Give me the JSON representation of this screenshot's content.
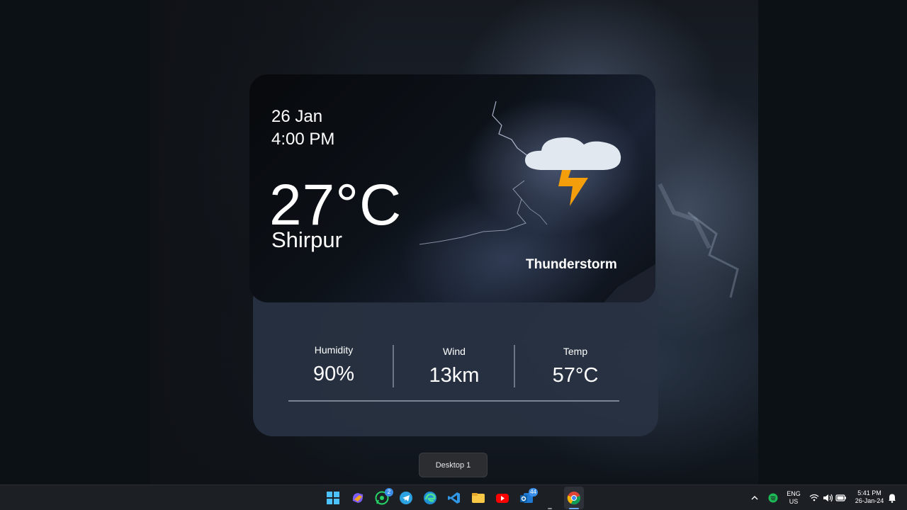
{
  "weather": {
    "date": "26 Jan",
    "time": "4:00 PM",
    "temperature": "27°C",
    "city": "Shirpur",
    "condition": "Thunderstorm",
    "icon": "thunderstorm-icon"
  },
  "stats": [
    {
      "label": "Humidity",
      "value": "90%"
    },
    {
      "label": "Wind",
      "value": "13km"
    },
    {
      "label": "Temp",
      "value": "57°C"
    }
  ],
  "desktop_tooltip": "Desktop 1",
  "taskbar": {
    "apps": [
      {
        "name": "start-icon"
      },
      {
        "name": "copilot-icon"
      },
      {
        "name": "whatsapp-icon",
        "badge": "2"
      },
      {
        "name": "telegram-icon"
      },
      {
        "name": "edge-icon"
      },
      {
        "name": "vscode-icon"
      },
      {
        "name": "file-explorer-icon"
      },
      {
        "name": "youtube-icon"
      },
      {
        "name": "outlook-icon",
        "badge": "44"
      },
      {
        "name": "chrome-icon"
      }
    ],
    "tray": {
      "lang_line1": "ENG",
      "lang_line2": "US",
      "clock_time": "5:41 PM",
      "clock_date": "26-Jan-24"
    }
  },
  "colors": {
    "accent_bolt": "#f59e0b",
    "cloud": "#e2e8f0",
    "card_bottom": "#283242"
  }
}
